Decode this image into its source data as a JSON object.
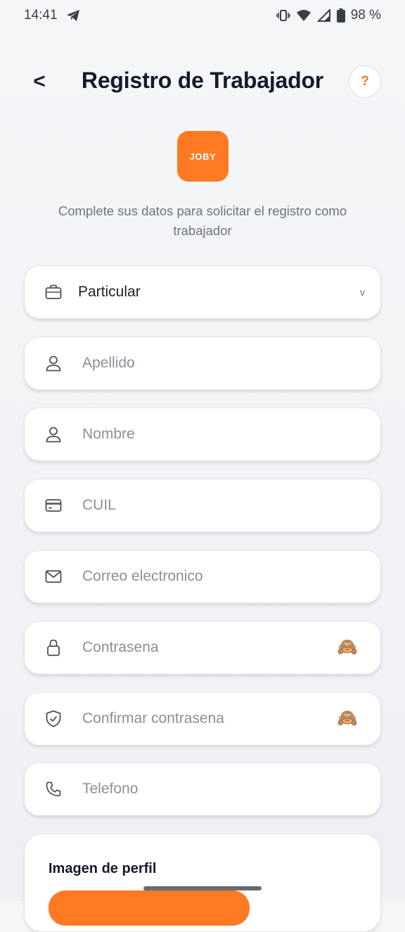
{
  "status": {
    "time": "14:41",
    "battery": "98 %"
  },
  "header": {
    "back_label": "<",
    "title": "Registro de Trabajador",
    "help_label": "?"
  },
  "logo": {
    "text": "JOBY"
  },
  "subtitle": "Complete sus datos para solicitar el registro como trabajador",
  "form": {
    "type_select": {
      "value": "Particular",
      "chevron": "v",
      "icon": "briefcase-icon"
    },
    "fields": [
      {
        "placeholder": "Apellido",
        "icon": "person-icon"
      },
      {
        "placeholder": "Nombre",
        "icon": "person-icon"
      },
      {
        "placeholder": "CUIL",
        "icon": "card-icon"
      },
      {
        "placeholder": "Correo electronico",
        "icon": "mail-icon"
      },
      {
        "placeholder": "Contrasena",
        "icon": "lock-icon",
        "toggle": "🙈"
      },
      {
        "placeholder": "Confirmar contrasena",
        "icon": "shield-icon",
        "toggle": "🙈"
      },
      {
        "placeholder": "Telefono",
        "icon": "phone-icon"
      }
    ]
  },
  "profile_image": {
    "title": "Imagen de perfil"
  },
  "colors": {
    "accent": "#ff7a22",
    "text": "#141a2a",
    "muted": "#8a8f98"
  }
}
